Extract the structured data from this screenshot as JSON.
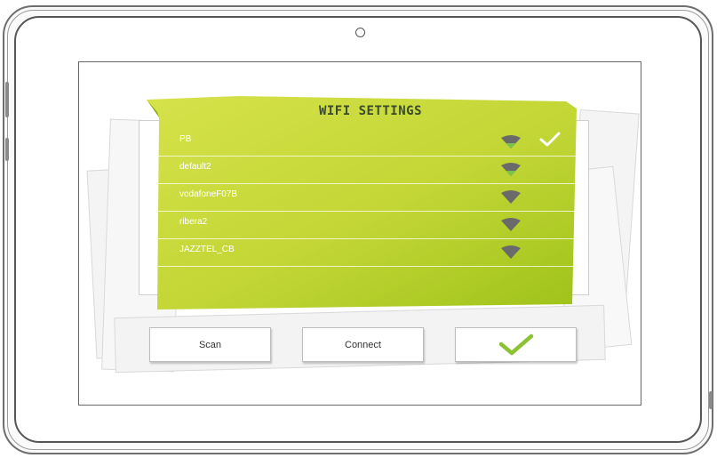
{
  "dialog": {
    "title": "WIFI SETTINGS"
  },
  "networks": [
    {
      "ssid": "PB",
      "selected": true,
      "signal_icon": "wifi-signal-icon",
      "signal_color": "#6a6a6a",
      "accent_color": "#7cc24a"
    },
    {
      "ssid": "default2",
      "selected": false,
      "signal_icon": "wifi-signal-icon",
      "signal_color": "#6a6a6a",
      "accent_color": "#7cc24a"
    },
    {
      "ssid": "vodafoneF07B",
      "selected": false,
      "signal_icon": "wifi-signal-icon",
      "signal_color": "#6a6a6a"
    },
    {
      "ssid": "ribera2",
      "selected": false,
      "signal_icon": "wifi-signal-icon",
      "signal_color": "#6a6a6a"
    },
    {
      "ssid": "JAZZTEL_CB",
      "selected": false,
      "signal_icon": "wifi-signal-icon",
      "signal_color": "#6a6a6a"
    }
  ],
  "buttons": {
    "scan_label": "Scan",
    "connect_label": "Connect",
    "confirm_icon": "checkmark-icon"
  },
  "colors": {
    "card_green_light": "#d6e24a",
    "card_green_dark": "#9fc21a",
    "check_green": "#8cc234"
  }
}
